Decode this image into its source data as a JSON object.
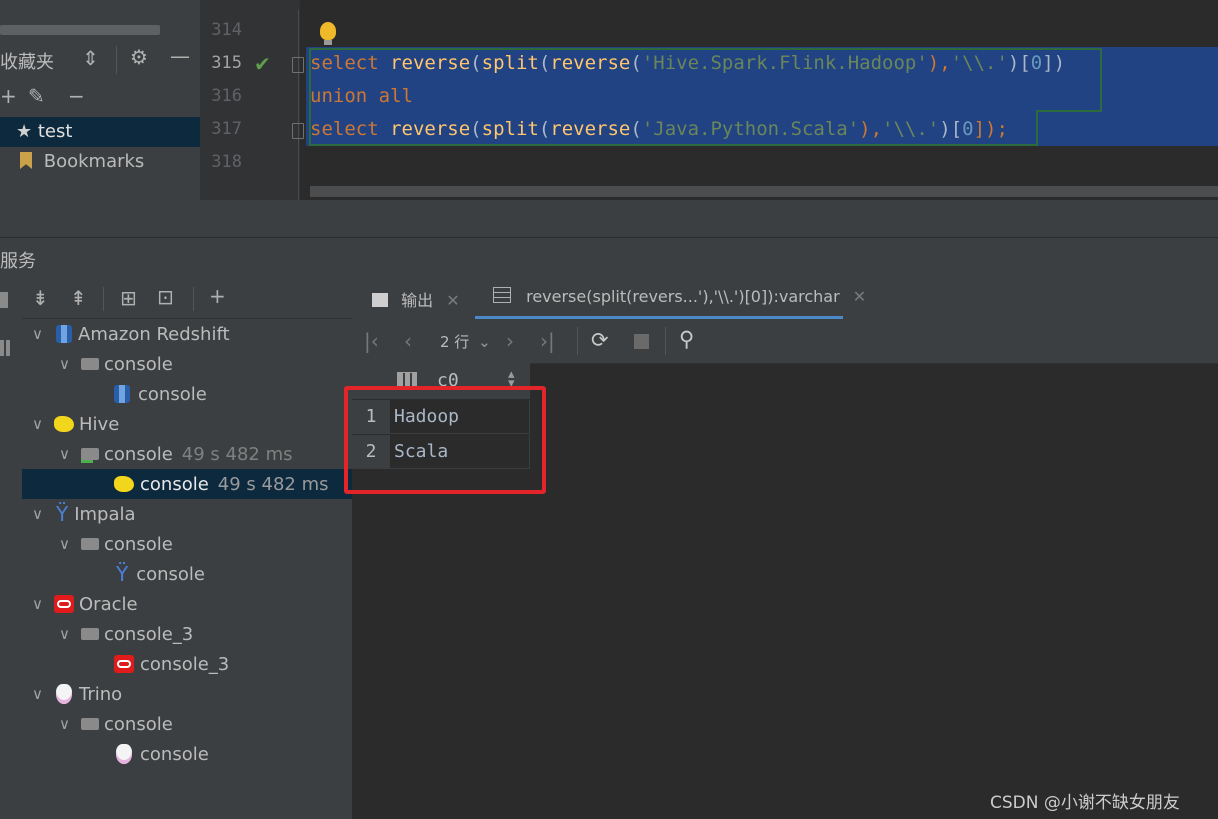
{
  "favorites": {
    "title": "收藏夹",
    "toolbar_icons": [
      "collapse-icon",
      "gear-icon",
      "minus-icon",
      "plus-icon",
      "edit-icon",
      "remove-icon"
    ],
    "items": [
      {
        "label": "test",
        "icon": "star-icon",
        "selected": true
      },
      {
        "label": "Bookmarks",
        "icon": "bookmark-icon",
        "selected": false
      }
    ]
  },
  "editor": {
    "line_numbers": [
      "314",
      "315",
      "316",
      "317",
      "318"
    ],
    "lines": [
      {
        "tokens": [
          "select",
          " ",
          "reverse",
          "(",
          "split",
          "(",
          "reverse",
          "(",
          "'Hive.Spark.Flink.Hadoop'",
          "),",
          "'\\\\.'",
          ")[",
          "0",
          "])"
        ]
      },
      {
        "tokens": [
          "union all"
        ]
      },
      {
        "tokens": [
          "select",
          " ",
          "reverse",
          "(",
          "split",
          "(",
          "reverse",
          "(",
          "'Java.Python.Scala'",
          "),",
          "'\\\\.'",
          ")[",
          "0",
          "]);"
        ]
      }
    ],
    "colors": {
      "keyword": "#cc7832",
      "function": "#ffc66d",
      "string": "#6a8759",
      "number": "#6897bb",
      "selection": "#214283"
    }
  },
  "services": {
    "title": "服务",
    "tree": [
      {
        "label": "Amazon Redshift",
        "icon": "redshift-icon",
        "level": 0
      },
      {
        "label": "console",
        "icon": "console-session-icon",
        "level": 1
      },
      {
        "label": "console",
        "icon": "redshift-icon",
        "level": 2
      },
      {
        "label": "Hive",
        "icon": "hive-icon",
        "level": 0
      },
      {
        "label": "console",
        "time": "49 s 482 ms",
        "icon": "console-session-icon",
        "level": 1
      },
      {
        "label": "console",
        "time": "49 s 482 ms",
        "icon": "hive-icon",
        "level": 2,
        "selected": true
      },
      {
        "label": "Impala",
        "icon": "impala-icon",
        "level": 0
      },
      {
        "label": "console",
        "icon": "console-session-icon",
        "level": 1
      },
      {
        "label": "console",
        "icon": "impala-icon",
        "level": 2
      },
      {
        "label": "Oracle",
        "icon": "oracle-icon",
        "level": 0
      },
      {
        "label": "console_3",
        "icon": "console-session-icon",
        "level": 1
      },
      {
        "label": "console_3",
        "icon": "oracle-icon",
        "level": 2
      },
      {
        "label": "Trino",
        "icon": "trino-icon",
        "level": 0
      },
      {
        "label": "console",
        "icon": "console-session-icon",
        "level": 1
      },
      {
        "label": "console",
        "icon": "trino-icon",
        "level": 2
      }
    ]
  },
  "results": {
    "tabs": [
      {
        "label": "输出",
        "icon": "console-output-icon"
      },
      {
        "label": "reverse(split(revers...'),'\\\\.')[0]):varchar",
        "icon": "table-icon",
        "active": true
      }
    ],
    "row_count_label": "2 行",
    "column": "c0",
    "rows": [
      {
        "num": "1",
        "value": "Hadoop"
      },
      {
        "num": "2",
        "value": "Scala"
      }
    ]
  },
  "watermark": "CSDN @小谢不缺女朋友"
}
